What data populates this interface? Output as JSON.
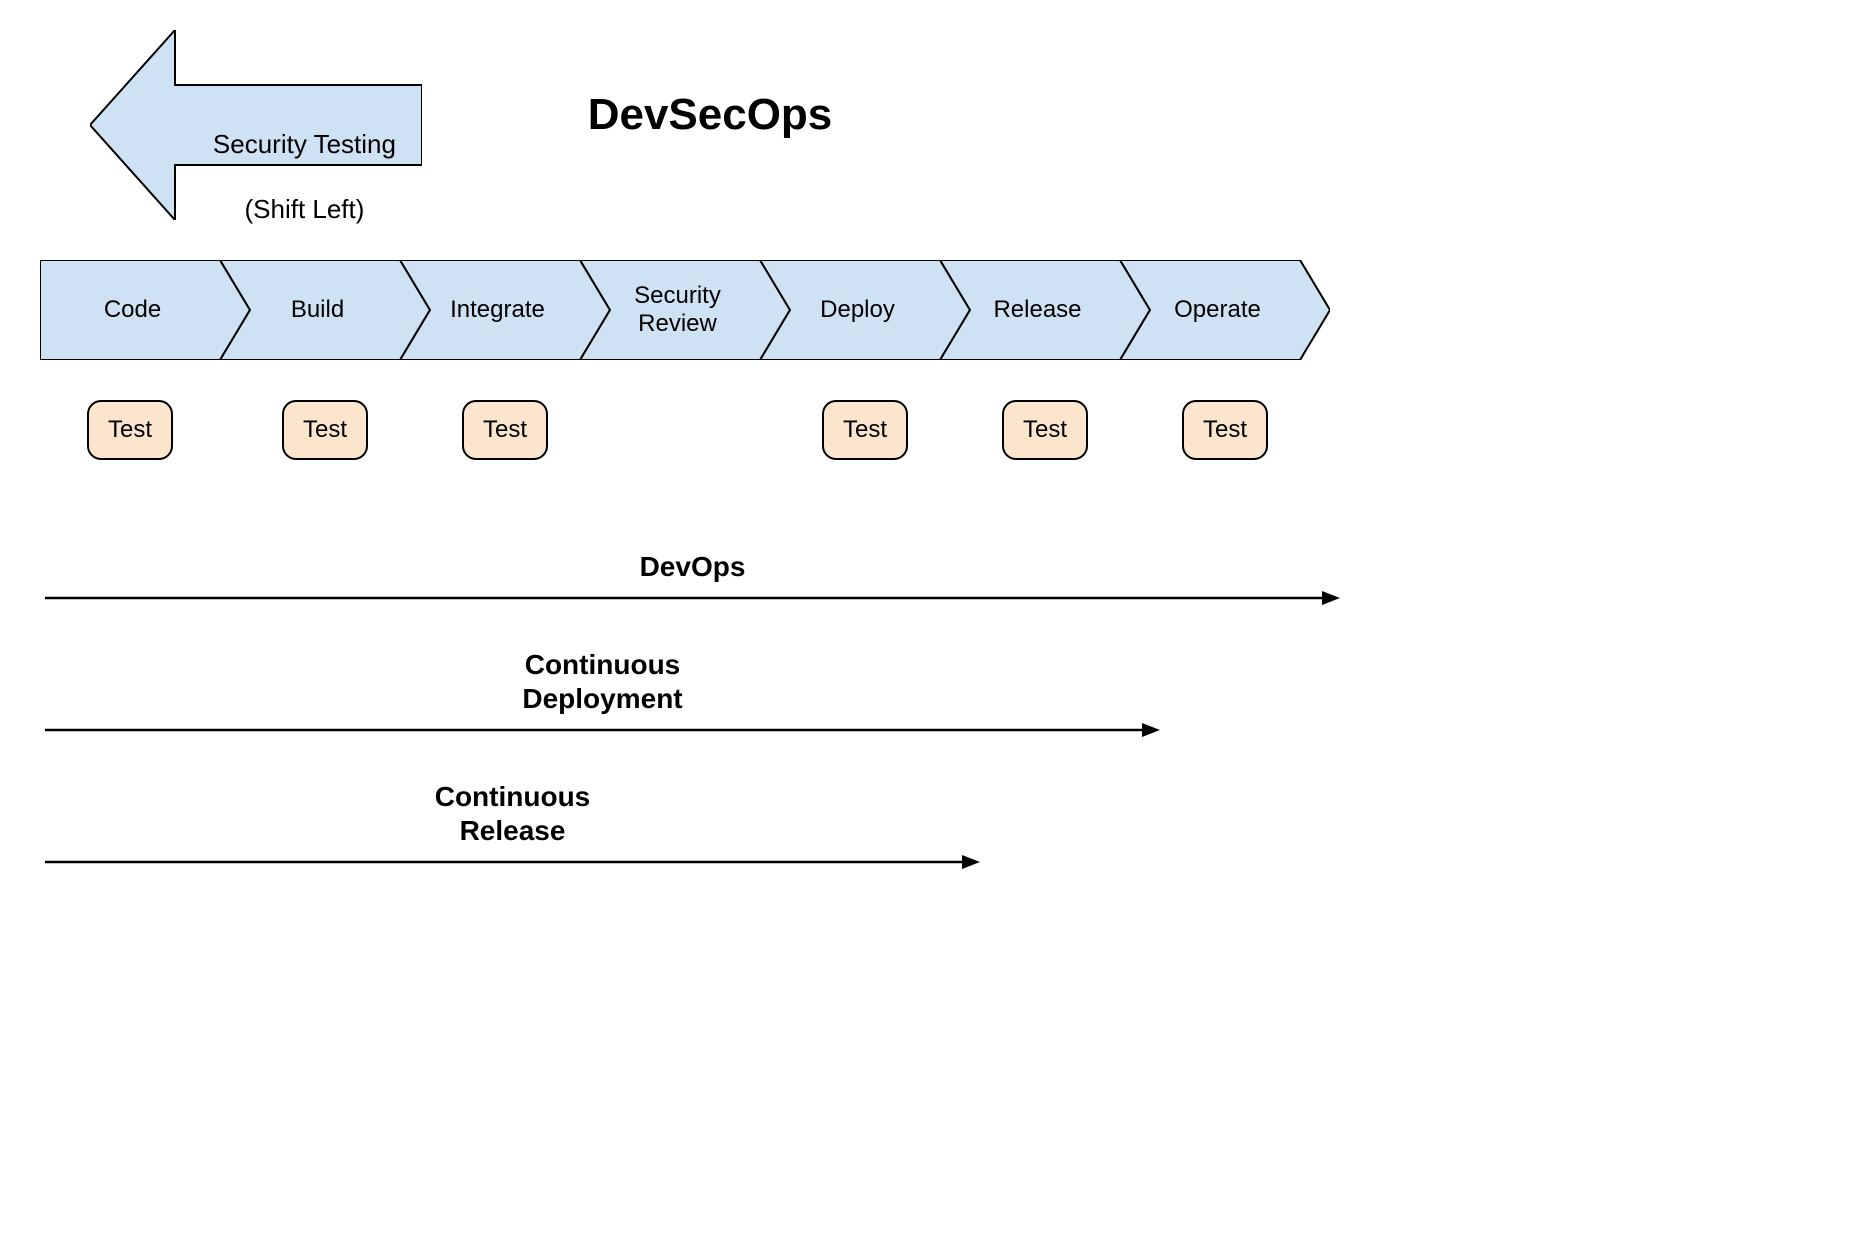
{
  "title": "DevSecOps",
  "shiftLeftArrow": {
    "line1": "Security Testing",
    "line2": "(Shift Left)"
  },
  "colors": {
    "chevronFill": "#CFE2F3",
    "chevronStroke": "#000000",
    "testFill": "#FCE5CD",
    "arrowStroke": "#000000"
  },
  "stages": [
    {
      "label": "Code",
      "hasTest": true
    },
    {
      "label": "Build",
      "hasTest": true
    },
    {
      "label": "Integrate",
      "hasTest": true
    },
    {
      "label": "Security\nReview",
      "hasTest": false
    },
    {
      "label": "Deploy",
      "hasTest": true
    },
    {
      "label": "Release",
      "hasTest": true
    },
    {
      "label": "Operate",
      "hasTest": true
    }
  ],
  "testLabel": "Test",
  "flows": [
    {
      "label": "DevOps",
      "endStageIndex": 6
    },
    {
      "label": "Continuous\nDeployment",
      "endStageIndex": 5
    },
    {
      "label": "Continuous\nRelease",
      "endStageIndex": 4
    }
  ]
}
